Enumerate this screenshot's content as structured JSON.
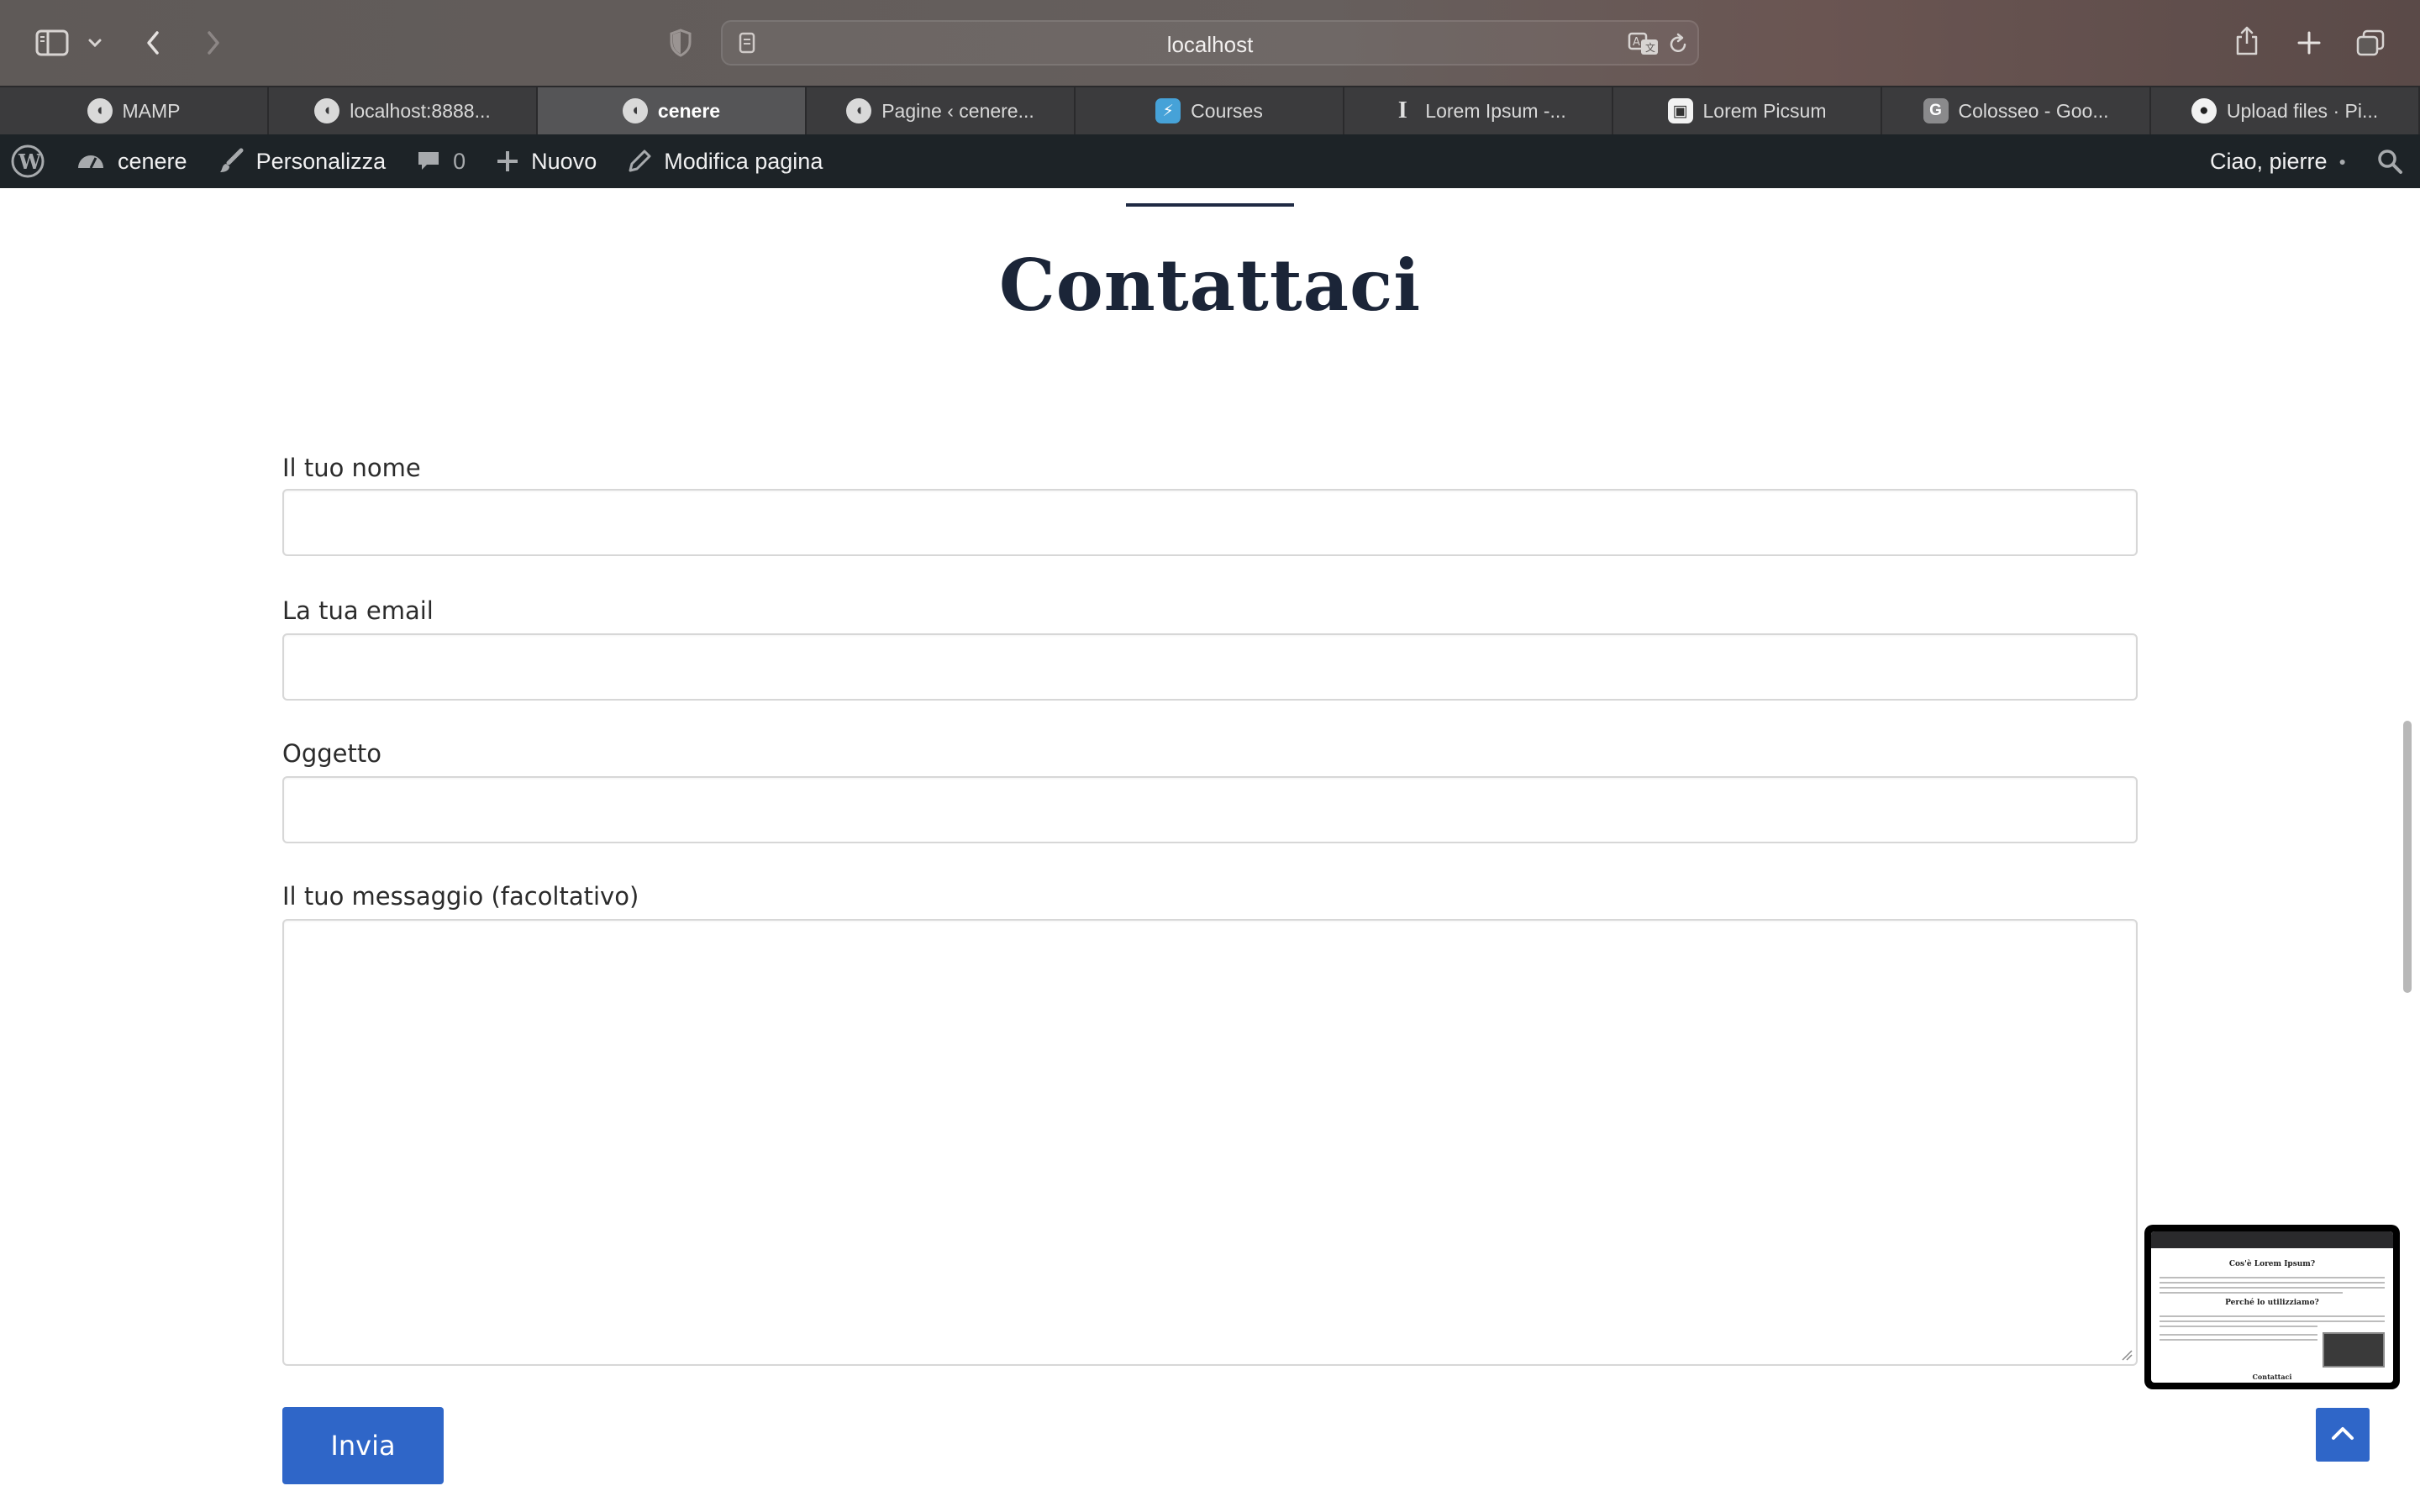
{
  "browser": {
    "address": "localhost",
    "tabs": [
      {
        "label": "MAMP",
        "icon": "mamp-elephant-icon",
        "active": false
      },
      {
        "label": "localhost:8888...",
        "icon": "mamp-elephant-icon",
        "active": false
      },
      {
        "label": "cenere",
        "icon": "mamp-elephant-icon",
        "active": true
      },
      {
        "label": "Pagine ‹ cenere...",
        "icon": "mamp-elephant-icon",
        "active": false
      },
      {
        "label": "Courses",
        "icon": "courses-icon",
        "active": false
      },
      {
        "label": "Lorem Ipsum -...",
        "icon": "lorem-ipsum-icon",
        "active": false
      },
      {
        "label": "Lorem Picsum",
        "icon": "picsum-icon",
        "active": false
      },
      {
        "label": "Colosseo - Goo...",
        "icon": "google-g-icon",
        "active": false
      },
      {
        "label": "Upload files · Pi...",
        "icon": "github-icon",
        "active": false
      }
    ]
  },
  "wp_admin_bar": {
    "site_name": "cenere",
    "customize": "Personalizza",
    "comments_count": "0",
    "new": "Nuovo",
    "edit_page": "Modifica pagina",
    "greeting": "Ciao, pierre"
  },
  "page": {
    "title": "Contattaci"
  },
  "form": {
    "name_label": "Il tuo nome",
    "email_label": "La tua email",
    "subject_label": "Oggetto",
    "message_label": "Il tuo messaggio (facoltativo)",
    "name_value": "",
    "email_value": "",
    "subject_value": "",
    "message_value": "",
    "submit_label": "Invia"
  },
  "pip_preview": {
    "heading_1": "Cos'è Lorem Ipsum?",
    "heading_2": "Perché lo utilizziamo?",
    "heading_3": "Contattaci"
  },
  "colors": {
    "accent": "#2f66c8",
    "admin_bar": "#1d2327",
    "title": "#1b2538"
  }
}
